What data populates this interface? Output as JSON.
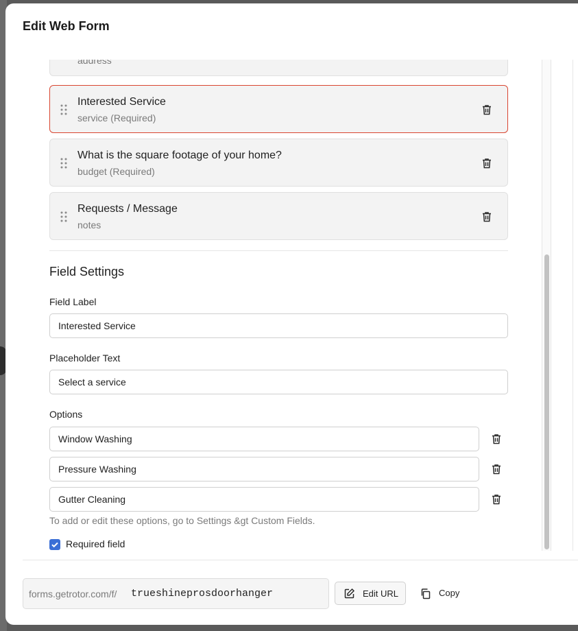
{
  "modal": {
    "title": "Edit Web Form"
  },
  "fields": [
    {
      "label": "",
      "sub": "address"
    },
    {
      "label": "Interested Service",
      "sub": "service (Required)",
      "selected": true
    },
    {
      "label": "What is the square footage of your home?",
      "sub": "budget (Required)"
    },
    {
      "label": "Requests / Message",
      "sub": "notes"
    }
  ],
  "field_settings": {
    "title": "Field Settings",
    "field_label_title": "Field Label",
    "field_label_value": "Interested Service",
    "placeholder_title": "Placeholder Text",
    "placeholder_value": "Select a service",
    "options_title": "Options",
    "options": [
      "Window Washing",
      "Pressure Washing",
      "Gutter Cleaning"
    ],
    "helper": "To add or edit these options, go to Settings &gt Custom Fields.",
    "required_label": "Required field",
    "required_checked": true
  },
  "footer": {
    "url_prefix": "forms.getrotor.com/f/",
    "url_slug": "trueshineprosdoorhanger",
    "edit_url_label": "Edit URL",
    "copy_label": "Copy"
  },
  "colors": {
    "selected_border": "#d9442f",
    "checkbox_accent": "#3b6fd6"
  },
  "icons": [
    "drag-handle-icon",
    "trash-icon",
    "checkmark-icon",
    "pencil-square-icon",
    "copy-icon"
  ]
}
